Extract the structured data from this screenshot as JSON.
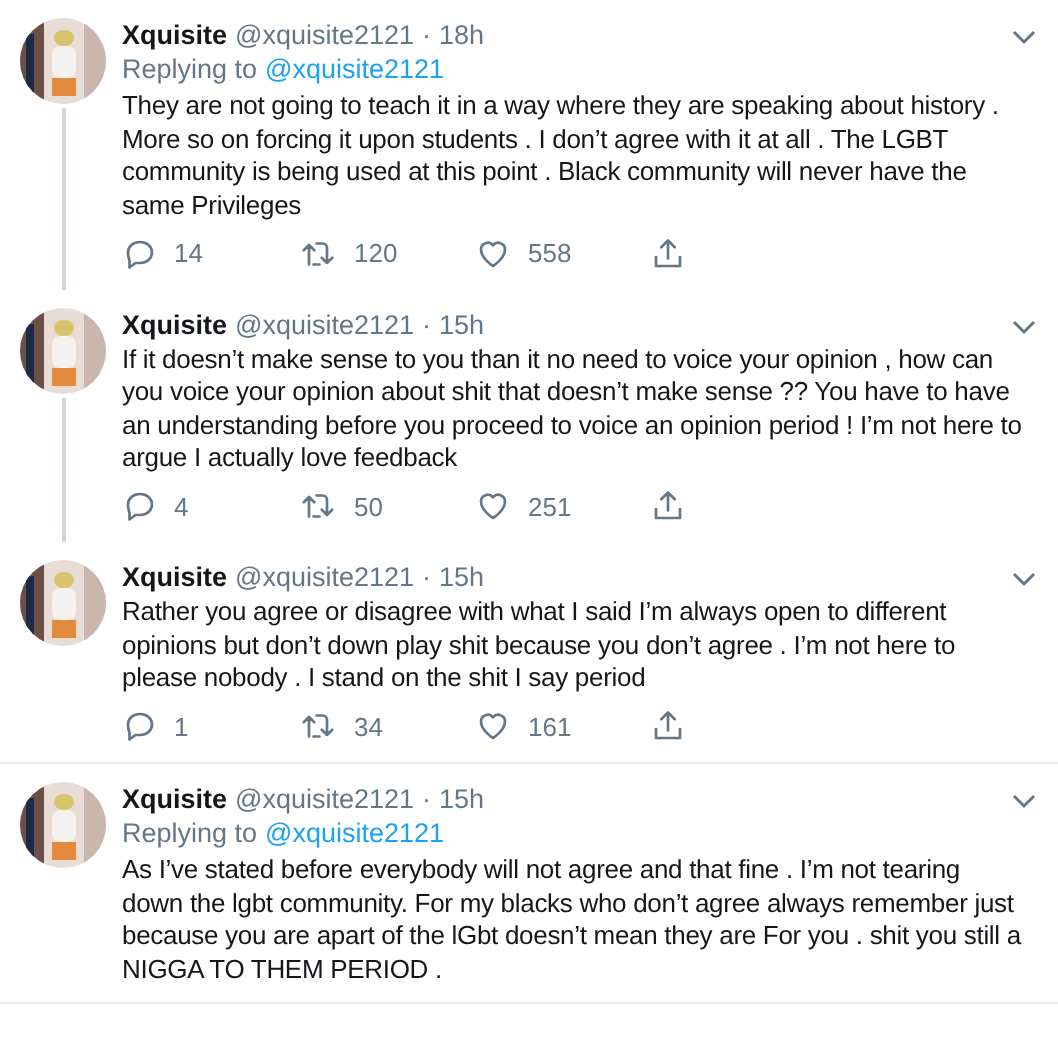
{
  "tweets": [
    {
      "name": "Xquisite",
      "handle": "@xquisite2121",
      "separator": "·",
      "time": "18h",
      "replying_label": "Replying to",
      "replying_to": "@xquisite2121",
      "text": "They are not going to teach it in a way where they are speaking about history . More so on forcing it upon students . I don’t agree with it at all . The LGBT community is being used at this point . Black community will never have the same Privileges",
      "replies": "14",
      "retweets": "120",
      "likes": "558",
      "thread_line_below": true
    },
    {
      "name": "Xquisite",
      "handle": "@xquisite2121",
      "separator": "·",
      "time": "15h",
      "text": "If it doesn’t make sense to you than it no need to voice your opinion , how can you voice your opinion about shit that doesn’t make sense ?? You have to have an understanding before you proceed to voice an opinion period ! I’m not here to argue I actually love feedback",
      "replies": "4",
      "retweets": "50",
      "likes": "251",
      "thread_line_below": true
    },
    {
      "name": "Xquisite",
      "handle": "@xquisite2121",
      "separator": "·",
      "time": "15h",
      "text": "Rather you agree or disagree with what I said I’m always open to different opinions but don’t down play shit because you don’t agree . I’m not here to please nobody . I stand on the shit I say period",
      "replies": "1",
      "retweets": "34",
      "likes": "161",
      "thread_line_below": false
    },
    {
      "name": "Xquisite",
      "handle": "@xquisite2121",
      "separator": "·",
      "time": "15h",
      "replying_label": "Replying to",
      "replying_to": "@xquisite2121",
      "text": "As I’ve stated before everybody will not agree and that fine . I’m not tearing down the lgbt community. For my blacks who don’t agree always remember just because you are apart of the lGbt doesn’t mean they are For you . shit you still a NIGGA TO THEM PERIOD .",
      "thread_line_below": false
    }
  ]
}
